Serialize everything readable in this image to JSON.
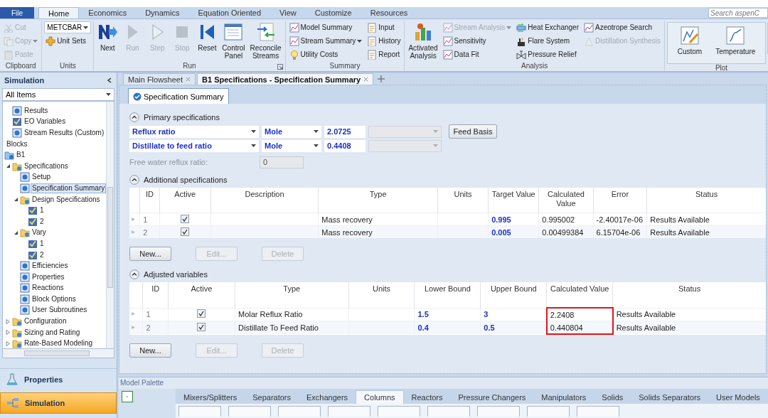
{
  "ribbon": {
    "file_tab": "File",
    "tabs": [
      {
        "label": "Home",
        "selected": true
      },
      {
        "label": "Economics",
        "selected": false
      },
      {
        "label": "Dynamics",
        "selected": false
      },
      {
        "label": "Equation Oriented",
        "selected": false
      },
      {
        "label": "View",
        "selected": false
      },
      {
        "label": "Customize",
        "selected": false
      },
      {
        "label": "Resources",
        "selected": false
      }
    ],
    "search": {
      "placeholder": "Search aspenC"
    },
    "groups": [
      {
        "label": "Clipboard",
        "kind": "buttons",
        "items": [
          {
            "label": "Cut",
            "kind": "small",
            "disabled": true
          },
          {
            "label": "Copy",
            "kind": "split",
            "disabled": true
          },
          {
            "label": "Paste",
            "kind": "small",
            "disabled": true
          }
        ]
      },
      {
        "label": "Units",
        "kind": "buttons",
        "items": [
          {
            "label": "METCBAR",
            "kind": "combo",
            "disabled": false
          },
          {
            "label": "Unit Sets",
            "kind": "small",
            "disabled": false
          }
        ]
      },
      {
        "label": "Run",
        "kind": "buttons",
        "launcher": true,
        "items": [
          {
            "label": "Next",
            "kind": "large",
            "disabled": false
          },
          {
            "label": "Run",
            "kind": "large",
            "disabled": true
          },
          {
            "label": "Step",
            "kind": "large",
            "disabled": true
          },
          {
            "label": "Stop",
            "kind": "large",
            "disabled": true
          },
          {
            "label": "Reset",
            "kind": "large",
            "disabled": false
          },
          {
            "label": "Control Panel",
            "kind": "large",
            "disabled": false
          },
          {
            "label": "Reconcile Streams",
            "kind": "large",
            "disabled": false
          }
        ]
      },
      {
        "label": "Summary",
        "kind": "buttons",
        "items": [
          {
            "label": "Model Summary",
            "kind": "small",
            "disabled": false
          },
          {
            "label": "Stream Summary",
            "kind": "split",
            "disabled": false
          },
          {
            "label": "Utility Costs",
            "kind": "small",
            "disabled": false
          },
          {
            "label": "Input",
            "kind": "small",
            "disabled": false
          },
          {
            "label": "History",
            "kind": "small",
            "disabled": false
          },
          {
            "label": "Report",
            "kind": "small",
            "disabled": false
          }
        ]
      },
      {
        "label": "Analysis",
        "kind": "buttons",
        "items": [
          {
            "label": "Activated Analysis",
            "kind": "large",
            "disabled": false
          },
          {
            "label": "Stream Analysis",
            "kind": "split",
            "disabled": true
          },
          {
            "label": "Sensitivity",
            "kind": "small",
            "disabled": false
          },
          {
            "label": "Data Fit",
            "kind": "small",
            "disabled": false
          },
          {
            "label": "Heat Exchanger",
            "kind": "small",
            "disabled": false
          },
          {
            "label": "Flare System",
            "kind": "small",
            "disabled": false
          },
          {
            "label": "Pressure Relief",
            "kind": "small",
            "disabled": false
          },
          {
            "label": "Azeotrope Search",
            "kind": "small",
            "disabled": false
          },
          {
            "label": "Distillation Synthesis",
            "kind": "small",
            "disabled": true
          }
        ]
      },
      {
        "label": "Plot",
        "kind": "gallery",
        "items": [
          {
            "label": "Custom",
            "kind": "large",
            "disabled": false
          },
          {
            "label": "Temperature",
            "kind": "large",
            "disabled": false
          }
        ]
      }
    ]
  },
  "sidebar": {
    "title": "Simulation",
    "filter": "All Items",
    "tree": [
      {
        "label": "Results",
        "kind": "form",
        "selected": false
      },
      {
        "label": "EO Variables",
        "kind": "check",
        "selected": false
      },
      {
        "label": "Stream Results (Custom)",
        "kind": "form",
        "selected": false
      },
      {
        "label": "Blocks",
        "kind": "heading",
        "selected": false
      },
      {
        "label": "B1",
        "kind": "block",
        "selected": false,
        "children": [
          {
            "label": "Specifications",
            "kind": "folder",
            "expanded": true,
            "selected": false,
            "children": [
              {
                "label": "Setup",
                "kind": "form",
                "selected": false
              },
              {
                "label": "Specification Summary",
                "kind": "form",
                "selected": true
              },
              {
                "label": "Design Specifications",
                "kind": "folder",
                "expanded": true,
                "selected": false,
                "children": [
                  {
                    "label": "1",
                    "kind": "check",
                    "selected": false
                  },
                  {
                    "label": "2",
                    "kind": "check",
                    "selected": false
                  }
                ]
              },
              {
                "label": "Vary",
                "kind": "folder",
                "expanded": true,
                "selected": false,
                "children": [
                  {
                    "label": "1",
                    "kind": "check",
                    "selected": false
                  },
                  {
                    "label": "2",
                    "kind": "check",
                    "selected": false
                  }
                ]
              },
              {
                "label": "Efficiencies",
                "kind": "form",
                "selected": false
              },
              {
                "label": "Properties",
                "kind": "form",
                "selected": false
              },
              {
                "label": "Reactions",
                "kind": "form",
                "selected": false
              },
              {
                "label": "Block Options",
                "kind": "form",
                "selected": false
              },
              {
                "label": "User Subroutines",
                "kind": "form",
                "selected": false
              }
            ]
          },
          {
            "label": "Configuration",
            "kind": "folder",
            "expanded": false,
            "selected": false
          },
          {
            "label": "Sizing and Rating",
            "kind": "folder",
            "expanded": false,
            "selected": false
          },
          {
            "label": "Rate-Based Modeling",
            "kind": "folder",
            "expanded": false,
            "selected": false
          }
        ]
      }
    ],
    "nav": [
      {
        "label": "Properties",
        "selected": false
      },
      {
        "label": "Simulation",
        "selected": true
      }
    ]
  },
  "document_tabs": [
    {
      "label": "Main Flowsheet",
      "selected": false
    },
    {
      "label": "B1 Specifications - Specification Summary",
      "selected": true
    }
  ],
  "form_tab": {
    "label": "Specification Summary"
  },
  "primary_specifications": {
    "title": "Primary specifications",
    "expanded": true,
    "rows": [
      {
        "spec": "Reflux ratio",
        "basis": "Mole",
        "value": "2.0725",
        "button": "Feed Basis"
      },
      {
        "spec": "Distillate to feed ratio",
        "basis": "Mole",
        "value": "0.4408"
      }
    ],
    "free_water": {
      "label": "Free water reflux ratio:",
      "value": "0",
      "disabled": true
    }
  },
  "additional_specifications": {
    "title": "Additional specifications",
    "expanded": true,
    "columns": [
      {
        "label": "ID",
        "highlighted": false
      },
      {
        "label": "Active",
        "highlighted": false
      },
      {
        "label": "Description",
        "highlighted": false
      },
      {
        "label": "Type",
        "highlighted": false
      },
      {
        "label": "Units",
        "highlighted": false
      },
      {
        "label": "Target Value",
        "highlighted": false
      },
      {
        "label": "Calculated Value",
        "highlighted": false
      },
      {
        "label": "Error",
        "highlighted": false
      },
      {
        "label": "Status",
        "highlighted": false
      }
    ],
    "rows": [
      {
        "id": "1",
        "active": true,
        "type": "Mass recovery",
        "target": "0.995",
        "calculated": "0.995002",
        "error": "-2.40017e-06",
        "status": "Results Available"
      },
      {
        "id": "2",
        "active": true,
        "type": "Mass recovery",
        "target": "0.005",
        "calculated": "0.00499384",
        "error": "6.15704e-06",
        "status": "Results Available"
      }
    ],
    "buttons": [
      {
        "label": "New...",
        "disabled": false
      },
      {
        "label": "Edit...",
        "disabled": true
      },
      {
        "label": "Delete",
        "disabled": true
      }
    ]
  },
  "adjusted_variables": {
    "title": "Adjusted variables",
    "expanded": true,
    "columns": [
      {
        "label": "ID",
        "highlighted": false
      },
      {
        "label": "Active",
        "highlighted": false
      },
      {
        "label": "Type",
        "highlighted": false
      },
      {
        "label": "Units",
        "highlighted": false
      },
      {
        "label": "Lower Bound",
        "highlighted": false
      },
      {
        "label": "Upper Bound",
        "highlighted": false
      },
      {
        "label": "Calculated Value",
        "highlighted": true
      },
      {
        "label": "Status",
        "highlighted": false
      }
    ],
    "rows": [
      {
        "id": "1",
        "active": true,
        "type": "Molar Reflux Ratio",
        "lower": "1.5",
        "upper": "3",
        "calculated": "2.2408",
        "status": "Results Available"
      },
      {
        "id": "2",
        "active": true,
        "type": "Distillate To Feed Ratio",
        "lower": "0.4",
        "upper": "0.5",
        "calculated": "0.440804",
        "status": "Results Available"
      }
    ],
    "buttons": [
      {
        "label": "New...",
        "disabled": false
      },
      {
        "label": "Edit...",
        "disabled": true
      },
      {
        "label": "Delete",
        "disabled": true
      }
    ]
  },
  "model_palette": {
    "title": "Model Palette",
    "tabs": [
      {
        "label": "Mixers/Splitters",
        "selected": false
      },
      {
        "label": "Separators",
        "selected": false
      },
      {
        "label": "Exchangers",
        "selected": false
      },
      {
        "label": "Columns",
        "selected": true
      },
      {
        "label": "Reactors",
        "selected": false
      },
      {
        "label": "Pressure Changers",
        "selected": false
      },
      {
        "label": "Manipulators",
        "selected": false
      },
      {
        "label": "Solids",
        "selected": false
      },
      {
        "label": "Solids Separators",
        "selected": false
      },
      {
        "label": "User Models",
        "selected": false
      }
    ]
  }
}
